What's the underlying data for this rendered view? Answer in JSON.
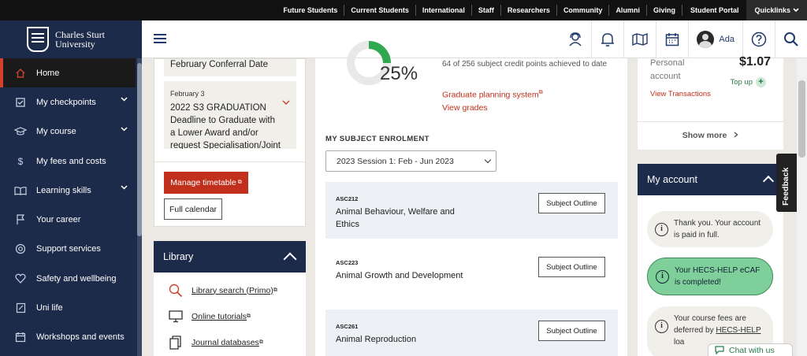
{
  "topbar": {
    "links": [
      "Future Students",
      "Current Students",
      "International",
      "Staff",
      "Researchers",
      "Community",
      "Alumni",
      "Giving"
    ],
    "student_portal": "Student Portal",
    "quicklinks": "Quicklinks"
  },
  "brand": {
    "line1": "Charles Sturt",
    "line2": "University"
  },
  "header": {
    "user_name": "Ada"
  },
  "sidebar": {
    "items": [
      {
        "label": "Home",
        "icon": "home-icon",
        "active": true
      },
      {
        "label": "My checkpoints",
        "icon": "checkpoints-icon",
        "chevron": true
      },
      {
        "label": "My course",
        "icon": "graduation-cap-icon",
        "chevron": true
      },
      {
        "label": "My fees and costs",
        "icon": "dollar-icon"
      },
      {
        "label": "Learning skills",
        "icon": "book-icon",
        "chevron": true
      },
      {
        "label": "Your career",
        "icon": "flag-icon"
      },
      {
        "label": "Support services",
        "icon": "support-icon"
      },
      {
        "label": "Safety and wellbeing",
        "icon": "heart-icon"
      },
      {
        "label": "Uni life",
        "icon": "uni-life-icon"
      },
      {
        "label": "Workshops and events",
        "icon": "calendar-icon"
      }
    ]
  },
  "events": {
    "item1_title": "February Conferral Date",
    "item2_date": "February 3",
    "item2_title": "2022 S3 GRADUATION Deadline to Graduate with a Lower Award and/or request Specialisation/Joint",
    "manage_timetable": "Manage timetable",
    "full_calendar": "Full calendar"
  },
  "library": {
    "title": "Library",
    "items": [
      {
        "label": "Library search (Primo)",
        "icon": "search-icon"
      },
      {
        "label": "Online tutorials",
        "icon": "monitor-icon"
      },
      {
        "label": "Journal databases",
        "icon": "documents-icon"
      }
    ]
  },
  "progress": {
    "percent_label": "25%",
    "percent": 25,
    "credits_text": "64 of 256 subject credit points achieved to date",
    "graduate_planning": "Graduate planning system",
    "view_grades": "View grades"
  },
  "enrolment": {
    "heading": "MY SUBJECT ENROLMENT",
    "session": "2023 Session 1: Feb - Jun 2023",
    "outline_label": "Subject Outline",
    "subjects": [
      {
        "code": "ASC212",
        "name": "Animal Behaviour, Welfare and Ethics"
      },
      {
        "code": "ASC223",
        "name": "Animal Growth and Development"
      },
      {
        "code": "ASC261",
        "name": "Animal Reproduction"
      }
    ]
  },
  "account_summary": {
    "label": "Personal account",
    "amount": "$1.07",
    "top_up": "Top up",
    "view_transactions": "View Transactions",
    "show_more": "Show more"
  },
  "my_account": {
    "title": "My account",
    "msg1": "Thank you. Your account is paid in full.",
    "msg2": "Your HECS-HELP eCAF is completed!",
    "msg3_prefix": "Your course fees are deferred by ",
    "msg3_link": "HECS-HELP",
    "msg3_suffix": " loa"
  },
  "feedback": "Feedback",
  "chat": "Chat with us",
  "colors": {
    "navy": "#1d2b4a",
    "accent_red": "#c0301c",
    "success_green": "#7fcf9b"
  }
}
